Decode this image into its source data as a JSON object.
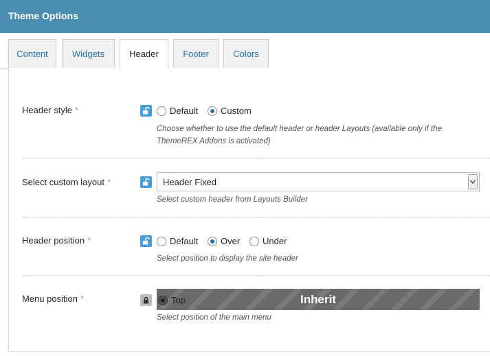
{
  "window": {
    "title": "Theme Options"
  },
  "tabs": [
    {
      "label": "Content"
    },
    {
      "label": "Widgets"
    },
    {
      "label": "Header",
      "active": true
    },
    {
      "label": "Footer"
    },
    {
      "label": "Colors"
    }
  ],
  "options": {
    "header_style": {
      "label": "Header style",
      "required_mark": "*",
      "choices": [
        "Default",
        "Custom"
      ],
      "selected": "Custom",
      "description_line1": "Choose whether to use the default header or header Layouts (available only if the",
      "description_line2": "ThemeREX Addons is activated)"
    },
    "custom_layout": {
      "label": "Select custom layout",
      "required_mark": "*",
      "value": "Header Fixed",
      "description": "Select custom header from Layouts Builder"
    },
    "header_position": {
      "label": "Header position",
      "required_mark": "*",
      "choices": [
        "Default",
        "Over",
        "Under"
      ],
      "selected": "Over",
      "description": "Select position to display the site header"
    },
    "menu_position": {
      "label": "Menu position",
      "required_mark": "*",
      "choices": [
        "Top"
      ],
      "selected": "Top",
      "overlay_text": "Inherit",
      "description": "Select position of the main menu"
    }
  },
  "colors": {
    "titlebar": "#4a8db0",
    "lock_unlocked": "#4a9fd6",
    "lock_locked": "#bbbbbb",
    "link": "#2271b1"
  },
  "icons": {
    "unlocked": "unlock-icon",
    "locked": "lock-icon",
    "select_arrow": "chevron-down-icon"
  }
}
